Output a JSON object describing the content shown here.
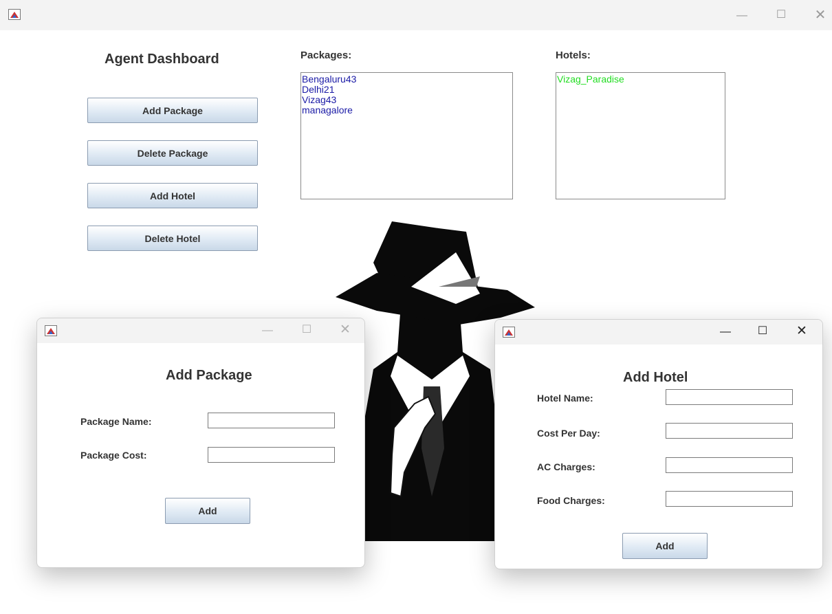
{
  "main_window": {
    "title_bar": {
      "icon": "java-app-icon",
      "controls": [
        "minimize-icon",
        "maximize-icon",
        "close-icon"
      ]
    },
    "heading": "Agent Dashboard",
    "buttons": {
      "add_package": "Add Package",
      "delete_package": "Delete Package",
      "add_hotel": "Add Hotel",
      "delete_hotel": "Delete Hotel"
    },
    "packages": {
      "label": "Packages:",
      "items": [
        "Bengaluru43",
        "Delhi21",
        "Vizag43",
        "managalore"
      ],
      "text_color": "#1a1aa6"
    },
    "hotels": {
      "label": "Hotels:",
      "items": [
        "Vizag_Paradise"
      ],
      "text_color": "#22dd22"
    },
    "background_image": "agent-silhouette"
  },
  "add_package_dialog": {
    "title_bar": {
      "icon": "java-app-icon",
      "controls": [
        "minimize-icon",
        "maximize-icon",
        "close-icon"
      ]
    },
    "heading": "Add Package",
    "fields": {
      "package_name": {
        "label": "Package Name:",
        "value": ""
      },
      "package_cost": {
        "label": "Package Cost:",
        "value": ""
      }
    },
    "add_button": "Add"
  },
  "add_hotel_dialog": {
    "title_bar": {
      "icon": "java-app-icon",
      "controls": [
        "minimize-icon",
        "maximize-icon",
        "close-icon"
      ]
    },
    "heading": "Add Hotel",
    "fields": {
      "hotel_name": {
        "label": "Hotel Name:",
        "value": ""
      },
      "cost_per_day": {
        "label": "Cost Per Day:",
        "value": ""
      },
      "ac_charges": {
        "label": "AC Charges:",
        "value": ""
      },
      "food_charges": {
        "label": "Food Charges:",
        "value": ""
      }
    },
    "add_button": "Add"
  }
}
